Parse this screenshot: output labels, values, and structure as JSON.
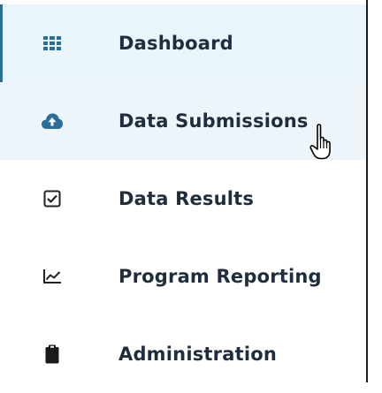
{
  "sidebar": {
    "items": [
      {
        "label": "Dashboard",
        "icon": "grid-icon",
        "state": "active"
      },
      {
        "label": "Data Submissions",
        "icon": "cloud-upload-icon",
        "state": "hovered"
      },
      {
        "label": "Data Results",
        "icon": "checkbox-icon",
        "state": "default"
      },
      {
        "label": "Program Reporting",
        "icon": "line-chart-icon",
        "state": "default"
      },
      {
        "label": "Administration",
        "icon": "clipboard-icon",
        "state": "default"
      }
    ]
  },
  "colors": {
    "active_background": "#e9f4fb",
    "active_border": "#2b6f98",
    "icon_accent": "#2b6f98",
    "text": "#1f2d3d"
  },
  "cursor": {
    "type": "hand-pointer-icon"
  }
}
